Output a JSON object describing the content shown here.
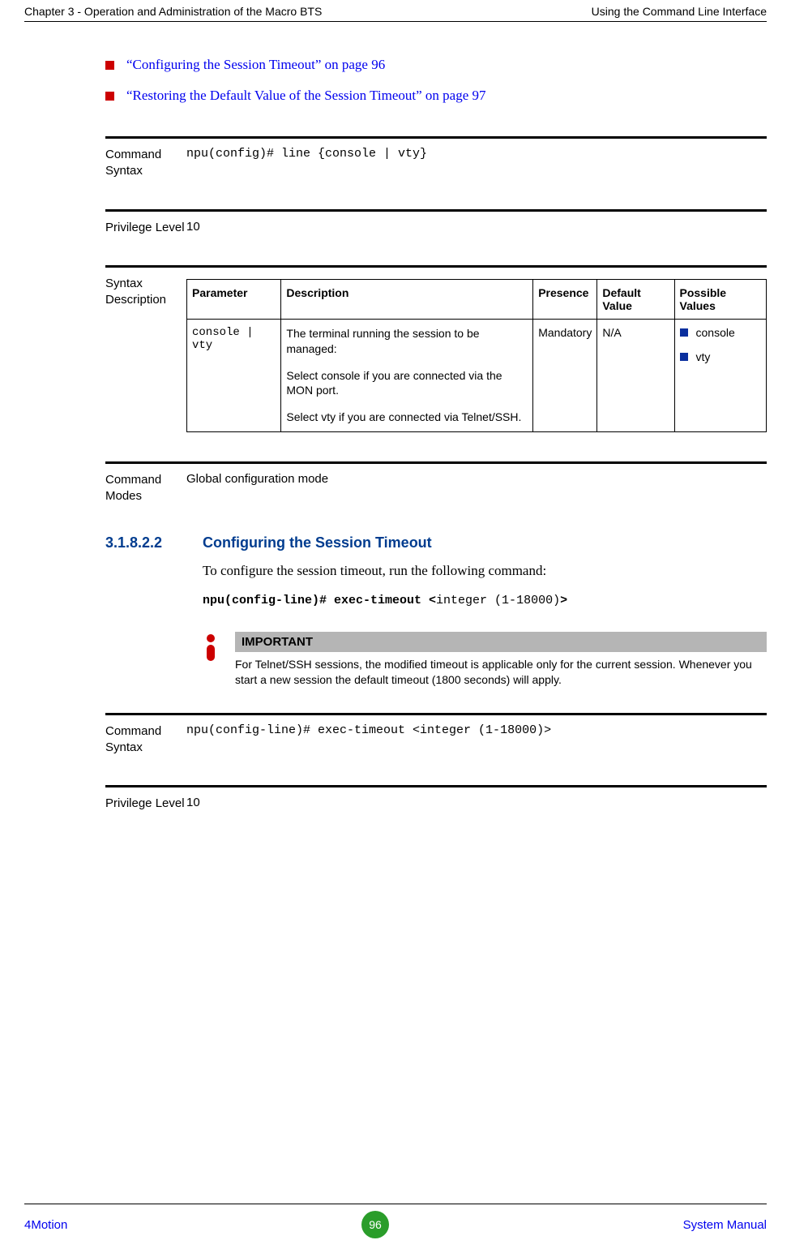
{
  "header": {
    "left": "Chapter 3 - Operation and Administration of the Macro BTS",
    "right": "Using the Command Line Interface"
  },
  "links": [
    "“Configuring the Session Timeout” on page 96",
    "“Restoring the Default Value of the Session Timeout” on page 97"
  ],
  "block1": {
    "cmd_syntax_label": "Command Syntax",
    "cmd_syntax_value": "npu(config)# line {console | vty}",
    "priv_label": "Privilege Level",
    "priv_value": "10",
    "syntax_desc_label": "Syntax Description",
    "table": {
      "headers": {
        "param": "Parameter",
        "desc": "Description",
        "presence": "Presence",
        "default": "Default Value",
        "possible": "Possible Values"
      },
      "row": {
        "param": "console | vty",
        "desc1": "The terminal running the session to be managed:",
        "desc2": "Select console if you are connected via the MON port.",
        "desc3": "Select vty if you are connected via Telnet/SSH.",
        "presence": "Mandatory",
        "default": "N/A",
        "pv1": "console",
        "pv2": "vty"
      }
    },
    "modes_label": "Command Modes",
    "modes_value": "Global configuration mode"
  },
  "section": {
    "num": "3.1.8.2.2",
    "title": "Configuring the Session Timeout",
    "intro": "To configure the session timeout, run the following command:",
    "cmd_bold": "npu(config-line)# exec-timeout <",
    "cmd_plain": "integer (1-18000)",
    "cmd_bold_end": ">",
    "important_label": "IMPORTANT",
    "important_text": "For Telnet/SSH sessions, the modified timeout is applicable only for the current session. Whenever you start a new session the default timeout (1800 seconds) will apply."
  },
  "block2": {
    "cmd_syntax_label": "Command Syntax",
    "cmd_syntax_value": "npu(config-line)# exec-timeout <integer (1-18000)>",
    "priv_label": "Privilege Level",
    "priv_value": "10"
  },
  "footer": {
    "left": "4Motion",
    "page": "96",
    "right": "System Manual"
  }
}
